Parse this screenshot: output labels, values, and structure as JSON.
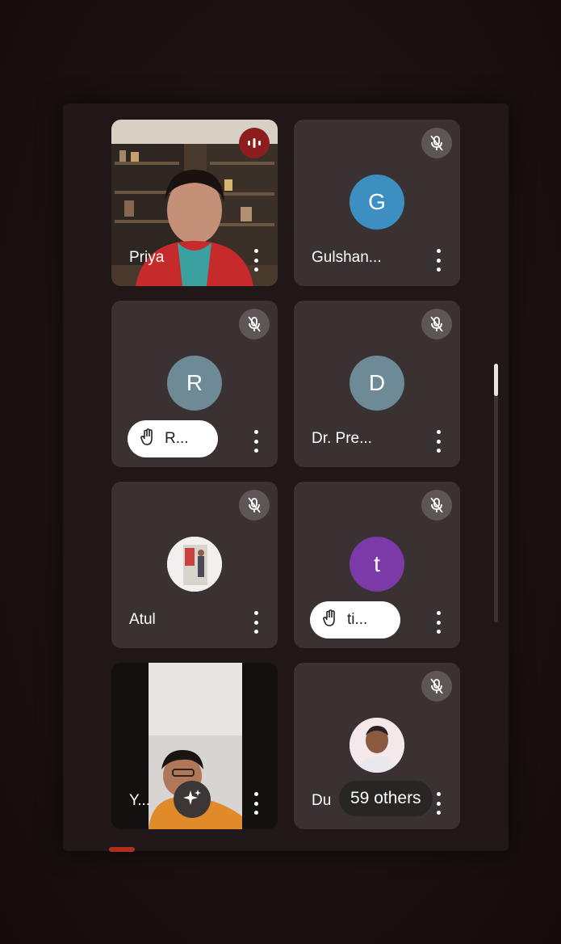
{
  "participants": [
    {
      "name": "Priya",
      "type": "video",
      "speaking": true
    },
    {
      "name": "Gulshan...",
      "initial": "G",
      "avatar_color": "#3d8fc2",
      "muted": true
    },
    {
      "name": "R...",
      "initial": "R",
      "avatar_color": "#6e8a96",
      "muted": true,
      "hand_raised": true
    },
    {
      "name": "Dr. Pre...",
      "initial": "D",
      "avatar_color": "#6e8a96",
      "muted": true
    },
    {
      "name": "Atul",
      "type": "photo",
      "muted": true
    },
    {
      "name": "ti...",
      "initial": "t",
      "avatar_color": "#7b3aa8",
      "muted": true,
      "hand_raised": true
    },
    {
      "name": "Y...",
      "type": "video"
    },
    {
      "name": "Du",
      "type": "photo",
      "muted": true
    }
  ],
  "others_label": "59 others",
  "colors": {
    "tile_bg": "#3a3232",
    "speaking_indicator": "#8e1e1e",
    "muted_badge": "#5e5656"
  }
}
